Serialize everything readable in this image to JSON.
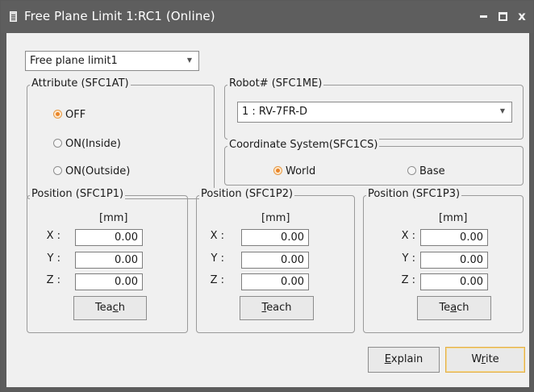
{
  "window": {
    "title": "Free Plane Limit 1:RC1 (Online)",
    "minimize_glyph": "",
    "close_glyph": "x"
  },
  "selector": {
    "value": "Free plane limit1"
  },
  "attribute": {
    "legend": "Attribute (SFC1AT)",
    "options": [
      {
        "label": "OFF",
        "selected": true
      },
      {
        "label": "ON(Inside)",
        "selected": false
      },
      {
        "label": "ON(Outside)",
        "selected": false
      }
    ]
  },
  "robot": {
    "legend": "Robot# (SFC1ME)",
    "value": "1 : RV-7FR-D"
  },
  "coordinate_system": {
    "legend": "Coordinate System(SFC1CS)",
    "options": [
      {
        "label": "World",
        "selected": true
      },
      {
        "label": "Base",
        "selected": false
      }
    ]
  },
  "positions": [
    {
      "legend": "Position (SFC1P1)",
      "unit": "[mm]",
      "x_label": "X :",
      "x": "0.00",
      "y_label": "Y :",
      "y": "0.00",
      "z_label": "Z :",
      "z": "0.00",
      "teach_pre": "Tea",
      "teach_key": "c",
      "teach_post": "h"
    },
    {
      "legend": "Position (SFC1P2)",
      "unit": "[mm]",
      "x_label": "X :",
      "x": "0.00",
      "y_label": "Y :",
      "y": "0.00",
      "z_label": "Z :",
      "z": "0.00",
      "teach_pre": "",
      "teach_key": "T",
      "teach_post": "each"
    },
    {
      "legend": "Position (SFC1P3)",
      "unit": "[mm]",
      "x_label": "X :",
      "x": "0.00",
      "y_label": "Y :",
      "y": "0.00",
      "z_label": "Z :",
      "z": "0.00",
      "teach_pre": "Te",
      "teach_key": "a",
      "teach_post": "ch"
    }
  ],
  "buttons": {
    "explain_key": "E",
    "explain_rest": "xplain",
    "write_pre": "W",
    "write_key": "r",
    "write_post": "ite"
  },
  "colors": {
    "titlebar": "#5e5e5e",
    "client": "#f0f0f0",
    "radio_selected": "#e9852a",
    "focus_border": "#e3b04a"
  }
}
